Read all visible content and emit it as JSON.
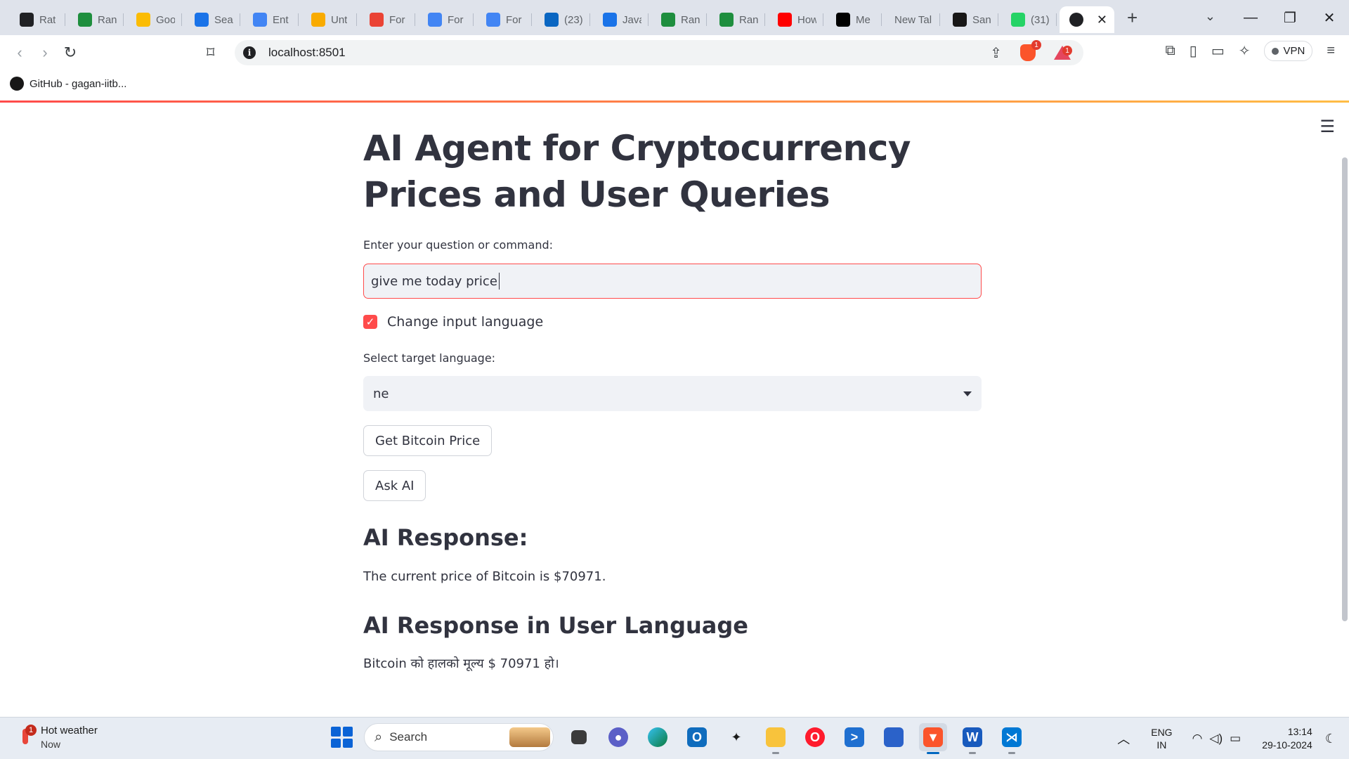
{
  "browser": {
    "tabs": [
      {
        "label": "Rat",
        "icon": "chatgpt-icon",
        "color": "#202124"
      },
      {
        "label": "Ran",
        "icon": "sheets-icon",
        "color": "#1e8e3e"
      },
      {
        "label": "Goo",
        "icon": "meet-icon",
        "color": "#fbbc04"
      },
      {
        "label": "Sea",
        "icon": "drive-icon",
        "color": "#1a73e8"
      },
      {
        "label": "Ent",
        "icon": "docs-icon",
        "color": "#4285f4"
      },
      {
        "label": "Unt",
        "icon": "colab-icon",
        "color": "#f9ab00"
      },
      {
        "label": "For",
        "icon": "gmail-icon",
        "color": "#ea4335"
      },
      {
        "label": "For",
        "icon": "docs-icon",
        "color": "#4285f4"
      },
      {
        "label": "For",
        "icon": "docs-icon",
        "color": "#4285f4"
      },
      {
        "label": "(23)",
        "icon": "linkedin-icon",
        "color": "#0a66c2"
      },
      {
        "label": "Java",
        "icon": "compass-icon",
        "color": "#1a73e8"
      },
      {
        "label": "Ran",
        "icon": "sheets-icon",
        "color": "#1e8e3e"
      },
      {
        "label": "Ran",
        "icon": "sheets-icon",
        "color": "#1e8e3e"
      },
      {
        "label": "How",
        "icon": "youtube-icon",
        "color": "#ff0000"
      },
      {
        "label": "Me",
        "icon": "medium-icon",
        "color": "#000000"
      },
      {
        "label": "New Tal",
        "icon": "",
        "color": ""
      },
      {
        "label": "San",
        "icon": "github-icon",
        "color": "#181717"
      },
      {
        "label": "(31)",
        "icon": "whatsapp-icon",
        "color": "#25d366"
      }
    ],
    "active_tab_close": "✕",
    "new_tab": "+",
    "url": "localhost:8501",
    "shield_badge": "1",
    "rewards_badge": "1",
    "vpn_label": "VPN",
    "bookmark": "GitHub - gagan-iitb..."
  },
  "app": {
    "title": "AI Agent for Cryptocurrency Prices and User Queries",
    "input_label": "Enter your question or command:",
    "input_value": "give me today price",
    "checkbox_label": "Change input language",
    "checkbox_checked": true,
    "select_label": "Select target language:",
    "select_value": "ne",
    "btn_bitcoin": "Get Bitcoin Price",
    "btn_ask": "Ask AI",
    "response_heading": "AI Response:",
    "response_text": "The current price of Bitcoin is $70971.",
    "user_lang_heading": "AI Response in User Language",
    "user_lang_text": "Bitcoin को हालको मूल्य $ 70971 हो।",
    "accent_color": "#ff4b4b"
  },
  "taskbar": {
    "weather_title": "Hot weather",
    "weather_sub": "Now",
    "weather_badge": "1",
    "search_placeholder": "Search",
    "lang_line1": "ENG",
    "lang_line2": "IN",
    "time": "13:14",
    "date": "29-10-2024"
  }
}
